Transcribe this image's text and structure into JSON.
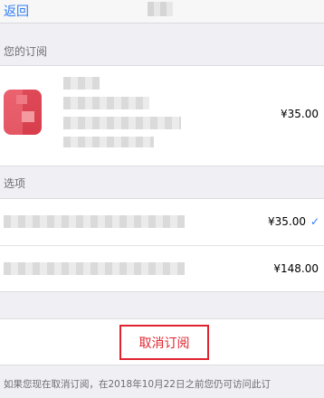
{
  "nav": {
    "back_label": "返回"
  },
  "subscription": {
    "section_title": "您的订阅",
    "price": "¥35.00"
  },
  "options": {
    "section_title": "选项",
    "items": [
      {
        "price": "¥35.00",
        "selected": true
      },
      {
        "price": "¥148.00",
        "selected": false
      }
    ]
  },
  "cancel": {
    "label": "取消订阅"
  },
  "footer": {
    "text": "如果您现在取消订阅，在2018年10月22日之前您仍可访问此订"
  },
  "colors": {
    "accent": "#2e7cf6",
    "danger": "#e0242f",
    "app_icon": "#e84d5b"
  }
}
